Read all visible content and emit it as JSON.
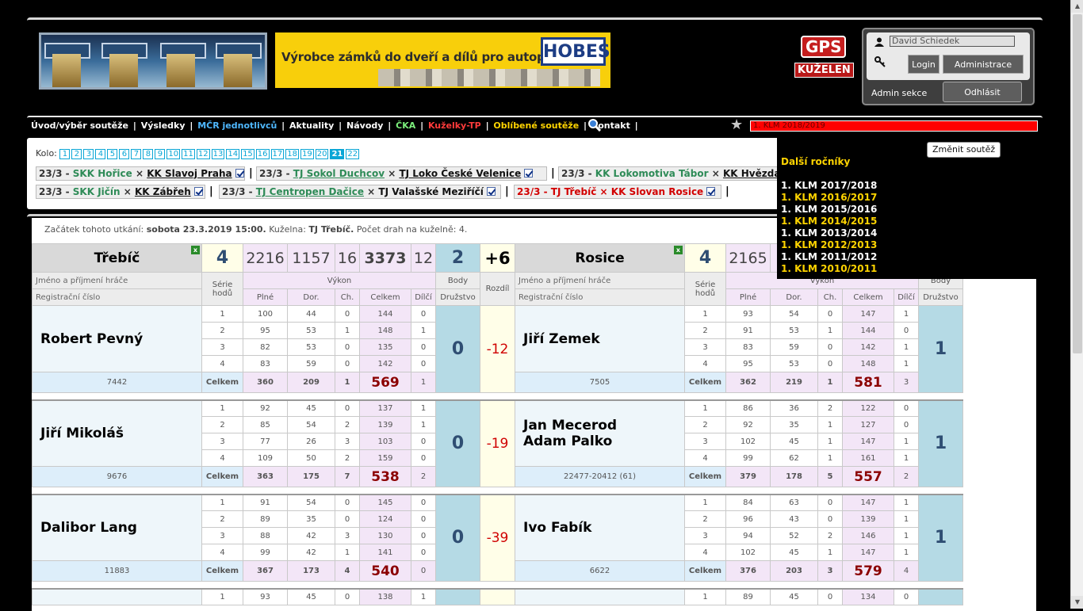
{
  "header": {
    "banner_text": "Výrobce zámků do dveří a dílů pro autoprůmysl",
    "banner_logo": "HOBES",
    "gps_logo_top": "GPS",
    "gps_logo_bottom": "KUŽELEN",
    "login": {
      "username": "David Schiedek",
      "login_label": "Login",
      "admin_label": "Administrace",
      "admin_section": "Admin sekce",
      "logout_label": "Odhlásit"
    }
  },
  "nav": {
    "items": [
      {
        "label": "Úvod/výběr soutěže",
        "color": "#ffffff"
      },
      {
        "label": "Výsledky",
        "color": "#ffffff"
      },
      {
        "label": "MČR jednotlivců",
        "color": "#4fb8ff"
      },
      {
        "label": "Aktuality",
        "color": "#ffffff"
      },
      {
        "label": "Návody",
        "color": "#ffffff"
      },
      {
        "label": "ČKA",
        "color": "#7cf07c"
      },
      {
        "label": "Kuželky-TP",
        "color": "#ff3b3b"
      },
      {
        "label": "Oblíbené soutěže",
        "color": "#ffd400"
      },
      {
        "label": "Kontakt",
        "color": "#ffffff"
      }
    ],
    "competition": "1. KLM 2018/2019"
  },
  "kolo": {
    "label": "Kolo:",
    "rounds": [
      "1",
      "2",
      "3",
      "4",
      "5",
      "6",
      "7",
      "8",
      "9",
      "10",
      "11",
      "12",
      "13",
      "14",
      "15",
      "16",
      "17",
      "18",
      "19",
      "20",
      "21",
      "22"
    ],
    "active": "21"
  },
  "matches": [
    {
      "date": "23/3",
      "home": "SKK Hořice",
      "away": "KK Slavoj Praha"
    },
    {
      "date": "23/3",
      "home": "TJ Sokol Duchcov",
      "away": "TJ Loko České Velenice"
    },
    {
      "date": "23/3",
      "home": "KK Lokomotiva Tábor",
      "away": "KK Hvězda"
    },
    {
      "date": "23/3",
      "home": "SKK Jičín",
      "away": "KK Zábřeh"
    },
    {
      "date": "23/3",
      "home": "TJ Centropen Dačice",
      "away": "TJ Valašské Meziříčí"
    },
    {
      "date": "23/3",
      "home": "TJ Třebíč",
      "away": "KK Slovan Rosice"
    }
  ],
  "dropdown": {
    "change_label": "Změnit soutěž",
    "heading": "Další ročníky",
    "years": [
      {
        "label": "1. KLM 2017/2018",
        "color": "#ffffff"
      },
      {
        "label": "1. KLM 2016/2017",
        "color": "#ffd400"
      },
      {
        "label": "1. KLM 2015/2016",
        "color": "#ffffff"
      },
      {
        "label": "1. KLM 2014/2015",
        "color": "#ffd400"
      },
      {
        "label": "1. KLM 2013/2014",
        "color": "#ffffff"
      },
      {
        "label": "1. KLM 2012/2013",
        "color": "#ffd400"
      },
      {
        "label": "1. KLM 2011/2012",
        "color": "#ffffff"
      },
      {
        "label": "1. KLM 2010/2011",
        "color": "#ffd400"
      }
    ]
  },
  "info": {
    "prefix": "Začátek tohoto utkání:",
    "date": "sobota 23.3.2019 15:00.",
    "kuzelna_label": "Kuželna:",
    "kuzelna": "TJ Třebíč.",
    "drahy": "Počet drah na kuželně: 4."
  },
  "score": {
    "home": {
      "name": "Třebíč",
      "points": "4",
      "plne": "2216",
      "dor": "1157",
      "ch": "16",
      "celkem": "3373",
      "dilci": "12",
      "body": "2"
    },
    "diff": "+6",
    "away": {
      "name": "Rosice",
      "points": "4",
      "plne": "2165"
    },
    "cols": {
      "jmeno": "Jméno a příjmení hráče",
      "reg": "Registrační číslo",
      "serie": "Série hodů",
      "vykon": "Výkon",
      "plne": "Plné",
      "dor": "Dor.",
      "ch": "Ch.",
      "celkem": "Celkem",
      "dilci": "Dílčí",
      "body": "Body",
      "druzstvo": "Družstvo",
      "rozdil": "Rozdíl"
    }
  },
  "players": [
    {
      "home": {
        "name": "Robert Pevný",
        "reg": "7442",
        "rows": [
          [
            "1",
            "100",
            "44",
            "0",
            "144",
            "0"
          ],
          [
            "2",
            "95",
            "53",
            "1",
            "148",
            "1"
          ],
          [
            "3",
            "82",
            "53",
            "0",
            "135",
            "0"
          ],
          [
            "4",
            "83",
            "59",
            "0",
            "142",
            "0"
          ]
        ],
        "tot": [
          "Celkem",
          "360",
          "209",
          "1",
          "569",
          "1"
        ]
      },
      "body_home": "0",
      "diff": "-12",
      "away": {
        "name": "Jiří Zemek",
        "reg": "7505",
        "rows": [
          [
            "1",
            "93",
            "54",
            "0",
            "147",
            "1"
          ],
          [
            "2",
            "91",
            "53",
            "1",
            "144",
            "0"
          ],
          [
            "3",
            "83",
            "59",
            "0",
            "142",
            "1"
          ],
          [
            "4",
            "95",
            "53",
            "0",
            "148",
            "1"
          ]
        ],
        "tot": [
          "Celkem",
          "362",
          "219",
          "1",
          "581",
          "3"
        ]
      },
      "body_away": "1"
    },
    {
      "home": {
        "name": "Jiří Mikoláš",
        "reg": "9676",
        "rows": [
          [
            "1",
            "92",
            "45",
            "0",
            "137",
            "1"
          ],
          [
            "2",
            "85",
            "54",
            "2",
            "139",
            "1"
          ],
          [
            "3",
            "77",
            "26",
            "3",
            "103",
            "0"
          ],
          [
            "4",
            "109",
            "50",
            "2",
            "159",
            "0"
          ]
        ],
        "tot": [
          "Celkem",
          "363",
          "175",
          "7",
          "538",
          "2"
        ]
      },
      "body_home": "0",
      "diff": "-19",
      "away": {
        "name": "Jan Mecerod",
        "name2": "Adam Palko",
        "reg": "22477-20412 (61)",
        "rows": [
          [
            "1",
            "86",
            "36",
            "2",
            "122",
            "0"
          ],
          [
            "2",
            "92",
            "35",
            "1",
            "127",
            "0"
          ],
          [
            "3",
            "102",
            "45",
            "1",
            "147",
            "1"
          ],
          [
            "4",
            "99",
            "62",
            "1",
            "161",
            "1"
          ]
        ],
        "tot": [
          "Celkem",
          "379",
          "178",
          "5",
          "557",
          "2"
        ]
      },
      "body_away": "1"
    },
    {
      "home": {
        "name": "Dalibor Lang",
        "reg": "11883",
        "rows": [
          [
            "1",
            "91",
            "54",
            "0",
            "145",
            "0"
          ],
          [
            "2",
            "89",
            "35",
            "0",
            "124",
            "0"
          ],
          [
            "3",
            "88",
            "42",
            "3",
            "130",
            "0"
          ],
          [
            "4",
            "99",
            "42",
            "1",
            "141",
            "0"
          ]
        ],
        "tot": [
          "Celkem",
          "367",
          "173",
          "4",
          "540",
          "0"
        ]
      },
      "body_home": "0",
      "diff": "-39",
      "away": {
        "name": "Ivo Fabík",
        "reg": "6622",
        "rows": [
          [
            "1",
            "84",
            "63",
            "0",
            "147",
            "1"
          ],
          [
            "2",
            "96",
            "43",
            "0",
            "139",
            "1"
          ],
          [
            "3",
            "94",
            "52",
            "2",
            "146",
            "1"
          ],
          [
            "4",
            "102",
            "45",
            "1",
            "147",
            "1"
          ]
        ],
        "tot": [
          "Celkem",
          "376",
          "203",
          "3",
          "579",
          "4"
        ]
      },
      "body_away": "1"
    },
    {
      "home": {
        "name": "",
        "reg": "",
        "rows": [
          [
            "1",
            "93",
            "45",
            "0",
            "138",
            "1"
          ]
        ],
        "tot": []
      },
      "away": {
        "name": "",
        "reg": "",
        "rows": [
          [
            "1",
            "89",
            "45",
            "0",
            "134",
            "0"
          ]
        ],
        "tot": []
      }
    }
  ]
}
